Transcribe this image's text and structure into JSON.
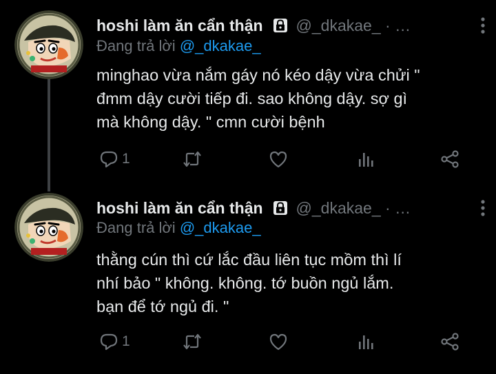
{
  "tweets": [
    {
      "display_name": "hoshi làm ăn cẩn thận",
      "handle": "@_dkakae_ · …",
      "replying_prefix": "Đang trả lời",
      "replying_to": "@_dkakae_",
      "lines": [
        "minghao vừa nắm gáy nó kéo dậy vừa chửi \"",
        "đmm dậy cười tiếp đi. sao không dậy. sợ gì",
        "mà không dậy. \" cmn cười bệnh"
      ],
      "reply_count": "1"
    },
    {
      "display_name": "hoshi làm ăn cẩn thận",
      "handle": "@_dkakae_ · …",
      "replying_prefix": "Đang trả lời",
      "replying_to": "@_dkakae_",
      "lines": [
        "thằng cún thì cứ lắc đầu liên tục mồm thì lí",
        "nhí bảo \" không. không. tớ buồn ngủ lắm.",
        "bạn để tớ ngủ đi. \""
      ],
      "reply_count": "1"
    }
  ],
  "icons": {
    "avatar": "cartoon-boy-avatar",
    "lock": "lock-icon",
    "more": "more-vertical-icon",
    "reply": "reply-bubble-icon",
    "retweet": "retweet-icon",
    "like": "heart-icon",
    "views": "bar-chart-icon",
    "share": "share-icon"
  },
  "colors": {
    "background": "#000000",
    "text": "#e7e9ea",
    "muted": "#71767b",
    "link": "#1d9bf0",
    "thread_line": "#3e4144"
  }
}
